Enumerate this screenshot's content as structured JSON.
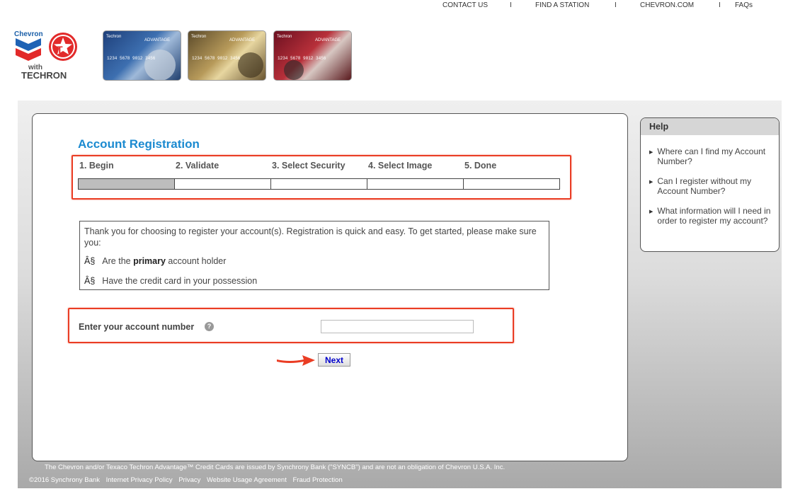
{
  "topnav": {
    "contact": "CONTACT US",
    "find_station": "FIND A STATION",
    "chevron_com": "CHEVRON.COM",
    "faqs": "FAQs",
    "sep": "I"
  },
  "logo": {
    "chevron": "Chevron",
    "with": "with",
    "techron": "TECHRON"
  },
  "cards": [
    {
      "brand": "ADVANTAGE",
      "issuer": "Techron",
      "number": "1234 5678 9012 3456"
    },
    {
      "brand": "ADVANTAGE",
      "issuer": "Techron",
      "number": "1234 5678 9012 3456"
    },
    {
      "brand": "ADVANTAGE",
      "issuer": "Techron",
      "number": "1234 5678 9012 3456"
    }
  ],
  "registration": {
    "title": "Account Registration",
    "steps": [
      "1. Begin",
      "2. Validate",
      "3. Select Security",
      "4. Select Image",
      "5. Done"
    ],
    "progress_completed_steps": 1,
    "intro": "Thank you for choosing to register your account(s). Registration is quick and easy. To get started, please make sure you:",
    "bullet_glyph": "Â§",
    "bullet1_pre": "Are the ",
    "bullet1_bold": "primary",
    "bullet1_post": " account holder",
    "bullet2": "Have the credit card in your possession",
    "account_label": "Enter your account number",
    "help_icon": "?",
    "account_value": "",
    "next_label": "Next"
  },
  "help": {
    "title": "Help",
    "items": [
      "Where can I find my Account Number?",
      "Can I register without my Account Number?",
      "What information will I need in order to register my account?"
    ]
  },
  "footer": {
    "disclaimer": "The Chevron and/or Texaco Techron Advantage™ Credit Cards are issued by Synchrony Bank (\"SYNCB\") and are not an obligation of Chevron U.S.A. Inc.",
    "copyright": "©2016 Synchrony Bank",
    "links": [
      "Internet Privacy Policy",
      "Privacy",
      "Website Usage Agreement",
      "Fraud Protection"
    ]
  },
  "colors": {
    "accent_blue": "#1b8ad0",
    "highlight_red": "#ea3d24",
    "link_blue": "#0000cc"
  }
}
